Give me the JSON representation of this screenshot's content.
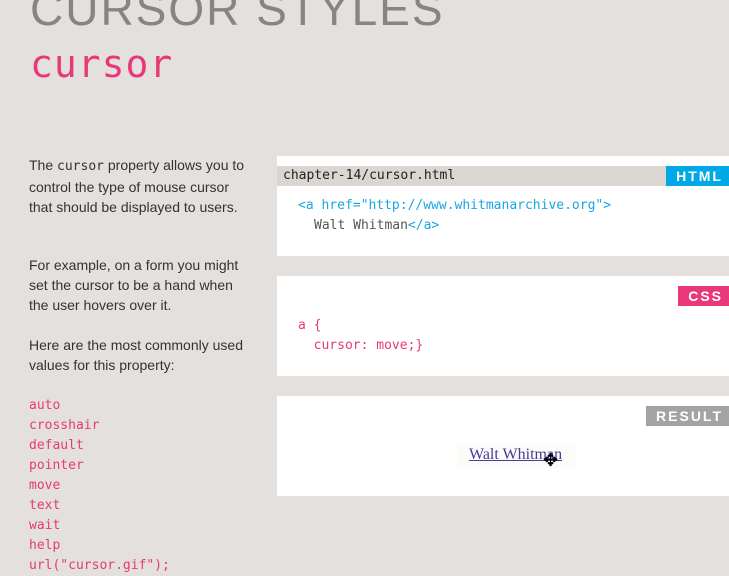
{
  "title": "CURSOR STYLES",
  "subtitle": "cursor",
  "intro": {
    "before": "The ",
    "code": "cursor",
    "after": " property allows you to control the type of mouse cursor that should be displayed to users."
  },
  "example": "For example, on a form you might set the cursor to be a hand when the user hovers over it.",
  "common": "Here are the most commonly used values for this property:",
  "values": [
    "auto",
    "crosshair",
    "default",
    "pointer",
    "move",
    "text",
    "wait",
    "help",
    "url(\"cursor.gif\");"
  ],
  "html_panel": {
    "file": "chapter-14/cursor.html",
    "tag": "HTML",
    "line1": "<a href=\"http://www.whitmanarchive.org\">",
    "line2_text": "Walt Whitman",
    "line2_close": "</a>"
  },
  "css_panel": {
    "tag": "CSS",
    "line1": "a {",
    "line2": "  cursor: move;}"
  },
  "result_panel": {
    "tag": "RESULT",
    "link": "Walt Whitman",
    "cursor_icon": "move-cursor-icon"
  },
  "colors": {
    "pink": "#e8387a",
    "blue": "#00a8e6",
    "gray": "#a3a3a5"
  }
}
